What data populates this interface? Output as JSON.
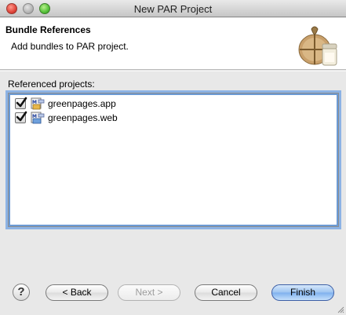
{
  "window": {
    "title": "New PAR Project"
  },
  "banner": {
    "title": "Bundle References",
    "description": "Add bundles to PAR project.",
    "image_icon": "par-wizard-icon"
  },
  "references": {
    "label": "Referenced projects:",
    "items": [
      {
        "label": "greenpages.app",
        "checked": true,
        "icon": "bundle-project-icon"
      },
      {
        "label": "greenpages.web",
        "checked": true,
        "icon": "web-bundle-project-icon"
      }
    ]
  },
  "buttons": {
    "help": "?",
    "back": "< Back",
    "next": "Next >",
    "cancel": "Cancel",
    "finish": "Finish"
  },
  "colors": {
    "default_button": "#7eb0ee",
    "focus_ring": "#8cb3e5"
  }
}
